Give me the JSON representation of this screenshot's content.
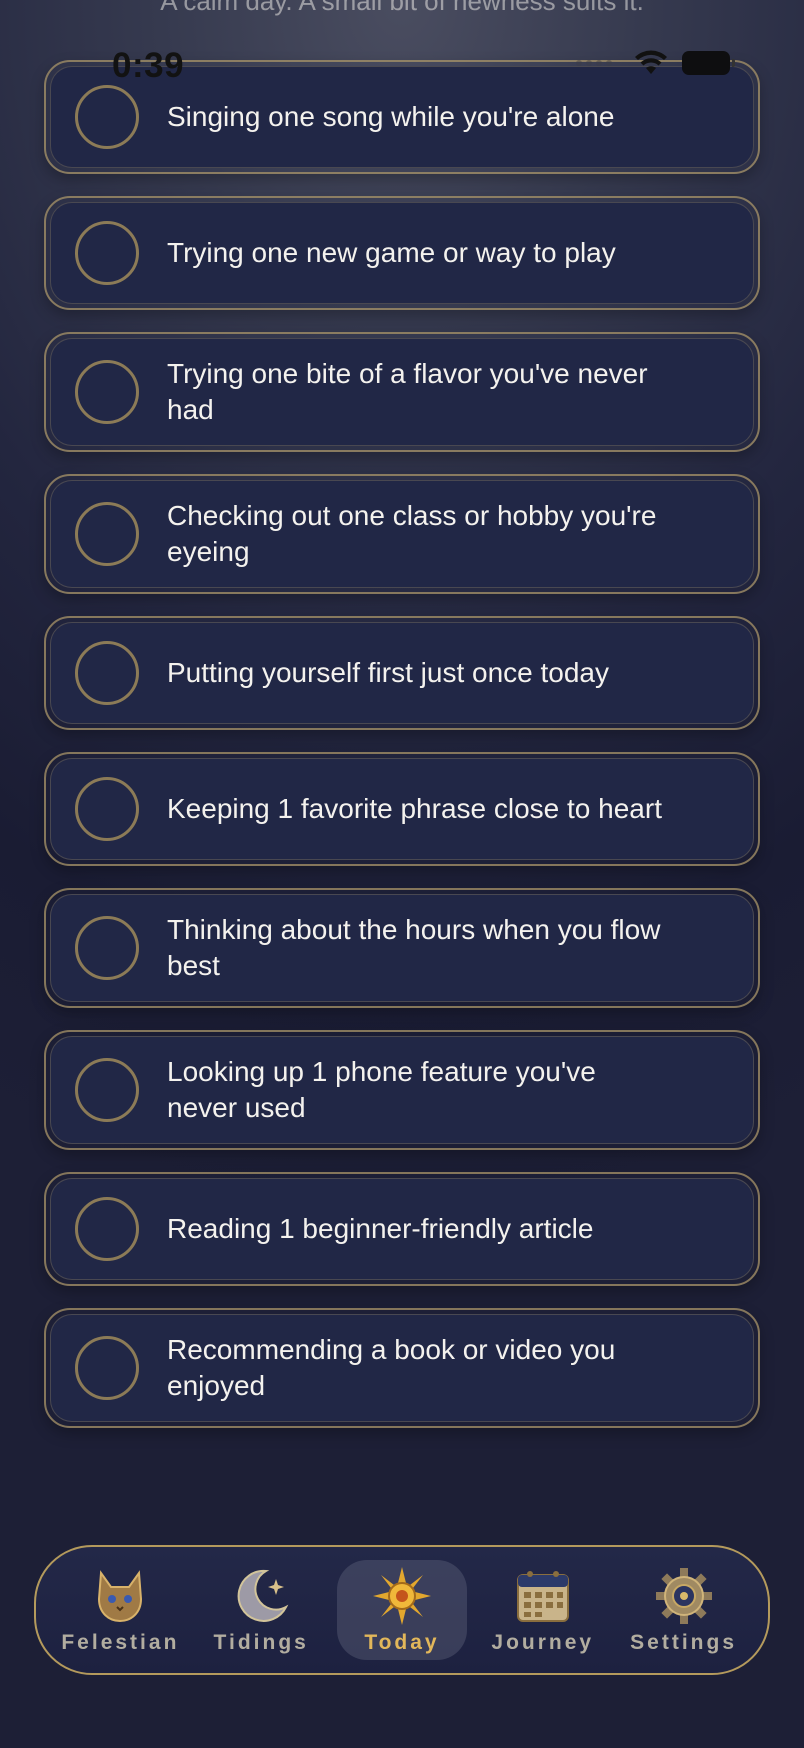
{
  "header": {
    "partial_text": "A calm day. A small bit of newness suits it."
  },
  "status_bar": {
    "time": "0:39"
  },
  "tasks": [
    {
      "label": "Singing one song while you're alone",
      "checked": false
    },
    {
      "label": "Trying one new game or way to play",
      "checked": false
    },
    {
      "label": "Trying one bite of a flavor you've never had",
      "checked": false
    },
    {
      "label": "Checking out one class or hobby you're eyeing",
      "checked": false
    },
    {
      "label": "Putting yourself first just once today",
      "checked": false
    },
    {
      "label": "Keeping 1 favorite phrase close to heart",
      "checked": false
    },
    {
      "label": "Thinking about the hours when you flow best",
      "checked": false
    },
    {
      "label": "Looking up 1 phone feature you've never used",
      "checked": false
    },
    {
      "label": "Reading 1 beginner-friendly article",
      "checked": false
    },
    {
      "label": "Recommending a book or video you enjoyed",
      "checked": false
    }
  ],
  "tabbar": {
    "tabs": [
      {
        "label": "Felestian",
        "icon": "cat-icon",
        "active": false
      },
      {
        "label": "Tidings",
        "icon": "crescent-moon-icon",
        "active": false
      },
      {
        "label": "Today",
        "icon": "sun-icon",
        "active": true
      },
      {
        "label": "Journey",
        "icon": "calendar-icon",
        "active": false
      },
      {
        "label": "Settings",
        "icon": "gear-icon",
        "active": false
      }
    ]
  },
  "colors": {
    "accent_gold": "#e2b75a",
    "card_fill": "#212746",
    "card_border": "#a89468",
    "background_dark": "#1a1c33"
  }
}
